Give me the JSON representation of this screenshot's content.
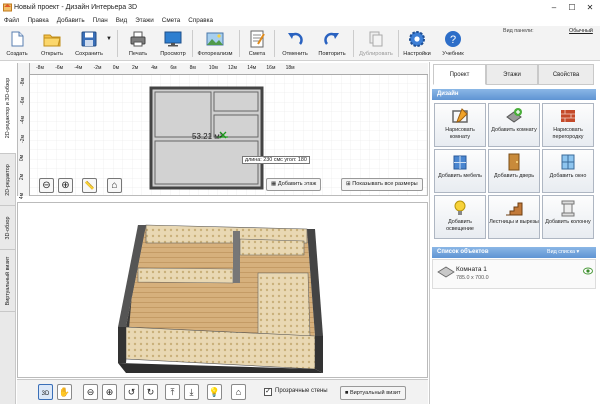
{
  "window": {
    "title": "Новый проект - Дизайн Интерьера 3D"
  },
  "menu": [
    "Файл",
    "Правка",
    "Добавить",
    "План",
    "Вид",
    "Этажи",
    "Смета",
    "Справка"
  ],
  "toolbar": {
    "buttons": [
      {
        "label": "Создать",
        "icon": "new-file-icon"
      },
      {
        "label": "Открыть",
        "icon": "open-folder-icon"
      },
      {
        "label": "Сохранить",
        "icon": "save-icon"
      },
      {
        "label": "Печать",
        "icon": "print-icon"
      },
      {
        "label": "Просмотр",
        "icon": "preview-monitor-icon"
      },
      {
        "label": "Фотореализм",
        "icon": "photorealism-icon"
      },
      {
        "label": "Смета",
        "icon": "estimate-icon"
      },
      {
        "label": "Отменить",
        "icon": "undo-icon"
      },
      {
        "label": "Повторить",
        "icon": "redo-icon"
      },
      {
        "label": "Дублировать",
        "icon": "duplicate-icon"
      },
      {
        "label": "Настройки",
        "icon": "settings-gear-icon"
      },
      {
        "label": "Учебник",
        "icon": "tutorial-help-icon"
      }
    ],
    "view_panel_label": "Вид панели:",
    "view_panel_value": "Обычный"
  },
  "left_tabs": [
    "2D-редактор и 3D-обзор",
    "2D-редактор",
    "3D-обзор",
    "Виртуальный визит"
  ],
  "plan2d": {
    "ruler_top": [
      "-8м",
      "-6м",
      "-4м",
      "-2м",
      "0м",
      "2м",
      "4м",
      "6м",
      "8м",
      "10м",
      "12м",
      "14м",
      "16м",
      "18м"
    ],
    "ruler_left": [
      "-8м",
      "-6м",
      "-4м",
      "-2м",
      "0м",
      "2м",
      "4м",
      "6м"
    ],
    "room_area": "53.21 м²",
    "tooltip": "длина: 230 смс угол: 180",
    "add_floor": "Добавить этаж",
    "show_sizes": "Показывать все размеры"
  },
  "bottom": {
    "transparent_walls": "Прозрачные стены",
    "virtual_visit": "Виртуальный визит"
  },
  "right_panel": {
    "tabs": [
      "Проект",
      "Этажи",
      "Свойства"
    ],
    "design_header": "Дизайн",
    "design_buttons": [
      {
        "label": "Нарисовать комнату",
        "icon": "draw-room-icon"
      },
      {
        "label": "Добавить комнату",
        "icon": "add-room-icon"
      },
      {
        "label": "Нарисовать перегородку",
        "icon": "draw-partition-icon"
      },
      {
        "label": "Добавить мебель",
        "icon": "add-furniture-icon"
      },
      {
        "label": "Добавить дверь",
        "icon": "add-door-icon"
      },
      {
        "label": "Добавить окно",
        "icon": "add-window-icon"
      },
      {
        "label": "Добавить освещение",
        "icon": "add-lighting-icon"
      },
      {
        "label": "Лестницы и вырезы",
        "icon": "stairs-icon"
      },
      {
        "label": "Добавить колонну",
        "icon": "add-column-icon"
      }
    ],
    "objects_header": "Список объектов",
    "objects_view": "Вид списка",
    "objects": [
      {
        "name": "Комната 1",
        "size": "785.0 x 700.0"
      }
    ]
  }
}
